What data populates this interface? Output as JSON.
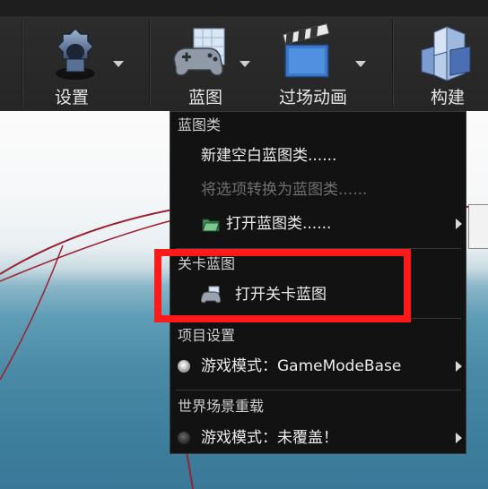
{
  "toolbar": {
    "settings": {
      "label": "设置",
      "icon": "gear-icon"
    },
    "blueprints": {
      "label": "蓝图",
      "icon": "gamepad-blueprint-icon"
    },
    "cinematics": {
      "label": "过场动画",
      "icon": "clapperboard-icon"
    },
    "build": {
      "label": "构建",
      "icon": "build-blocks-icon"
    }
  },
  "menu": {
    "section_blueprint_class": "蓝图类",
    "new_empty_blueprint": "新建空白蓝图类......",
    "convert_selection": "将选项转换为蓝图类......",
    "open_blueprint_class": "打开蓝图类......",
    "section_level_blueprint": "关卡蓝图",
    "open_level_blueprint": "打开关卡蓝图",
    "section_project_settings": "项目设置",
    "game_mode_project": "游戏模式：GameModeBase",
    "section_world_override": "世界场景重载",
    "game_mode_world": "游戏模式：未覆盖！"
  },
  "colors": {
    "highlight": "#ff1a1a",
    "menu_bg": "#121212",
    "toolbar_bg": "#2a2a2a"
  }
}
